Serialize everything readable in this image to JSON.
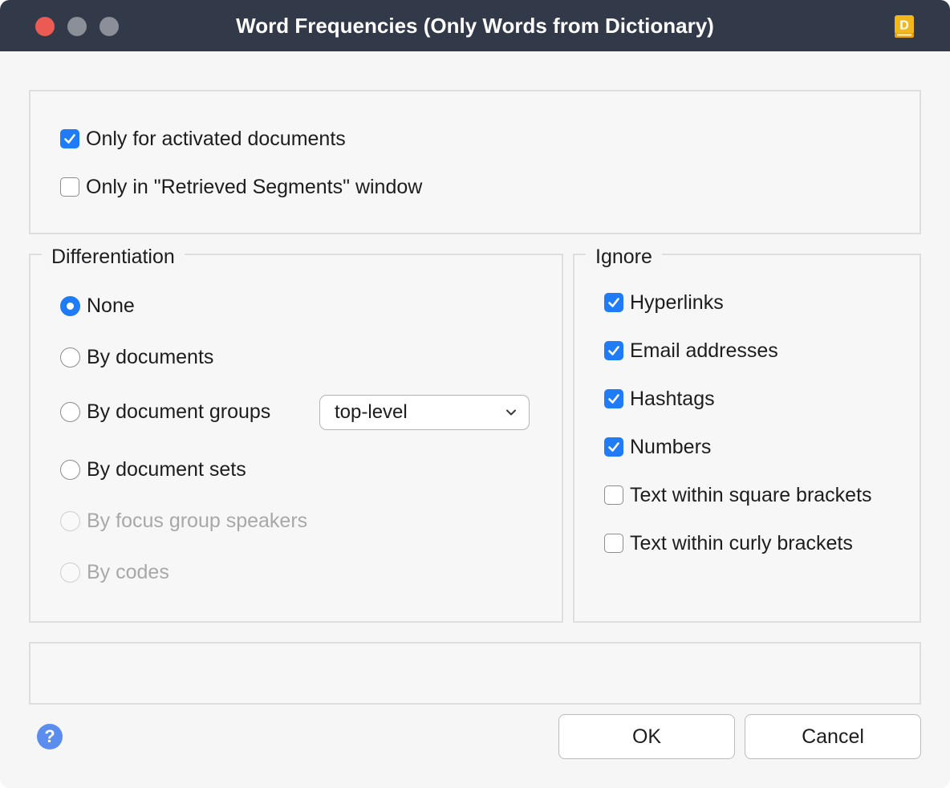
{
  "window": {
    "title": "Word Frequencies (Only Words from Dictionary)",
    "app_icon": "dictionary-book-icon",
    "app_icon_letter": "D",
    "accent_color": "#1f7bf6"
  },
  "scope": {
    "only_activated": {
      "label": "Only for activated documents",
      "checked": true
    },
    "only_retrieved": {
      "label": "Only in \"Retrieved Segments\" window",
      "checked": false
    }
  },
  "differentiation": {
    "legend": "Differentiation",
    "options": [
      {
        "label": "None",
        "selected": true,
        "enabled": true
      },
      {
        "label": "By documents",
        "selected": false,
        "enabled": true
      },
      {
        "label": "By document groups",
        "selected": false,
        "enabled": true
      },
      {
        "label": "By document sets",
        "selected": false,
        "enabled": true
      },
      {
        "label": "By focus group speakers",
        "selected": false,
        "enabled": false
      },
      {
        "label": "By codes",
        "selected": false,
        "enabled": false
      }
    ],
    "group_level": {
      "value": "top-level"
    }
  },
  "ignore": {
    "legend": "Ignore",
    "options": [
      {
        "label": "Hyperlinks",
        "checked": true
      },
      {
        "label": "Email addresses",
        "checked": true
      },
      {
        "label": "Hashtags",
        "checked": true
      },
      {
        "label": "Numbers",
        "checked": true
      },
      {
        "label": "Text within square brackets",
        "checked": false
      },
      {
        "label": "Text within curly brackets",
        "checked": false
      }
    ]
  },
  "footer": {
    "help_label": "?",
    "ok_label": "OK",
    "cancel_label": "Cancel"
  }
}
